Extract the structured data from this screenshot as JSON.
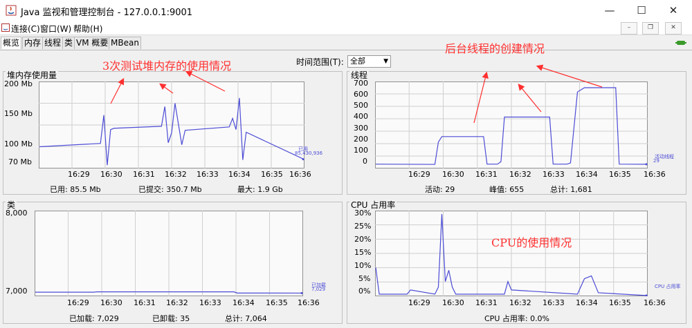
{
  "window": {
    "title": "Java 监视和管理控制台 - 127.0.0.1:9001",
    "minimize": "—",
    "maximize": "☐",
    "close": "✕"
  },
  "menu": {
    "items": [
      "连接(C)",
      "窗口(W)",
      "帮助(H)"
    ],
    "mdi_min": "–",
    "mdi_restore": "❐",
    "mdi_close": "✕"
  },
  "tabs": [
    "概览",
    "内存",
    "线程",
    "类",
    "VM 概要",
    "MBean"
  ],
  "time_range": {
    "label": "时间范围(T):",
    "value": "全部"
  },
  "annotations": {
    "heap": "3次测试堆内存的使用情况",
    "threads": "后台线程的创建情况",
    "cpu": "CPU的使用情况"
  },
  "x_ticks": [
    "16:29",
    "16:30",
    "16:31",
    "16:32",
    "16:33",
    "16:34",
    "16:35",
    "16:36"
  ],
  "heap": {
    "title": "堆内存使用量",
    "y_ticks": [
      "200 Mb",
      "150 Mb",
      "100 Mb",
      "70 Mb"
    ],
    "legend": "已用",
    "legend_value": "85,430,936",
    "footer": {
      "used": "已用:  85.5  Mb",
      "committed": "已提交:  350.7  Mb",
      "max": "最大:  1.9  Gb"
    }
  },
  "threads": {
    "title": "线程",
    "y_ticks": [
      "700",
      "600",
      "500",
      "400",
      "300",
      "200",
      "100",
      "0"
    ],
    "legend": "活动线程",
    "legend_value": "29",
    "footer": {
      "live": "活动:  29",
      "peak": "峰值:  655",
      "total": "总计:  1,681"
    }
  },
  "classes": {
    "title": "类",
    "y_ticks": [
      "8,000",
      "7,000"
    ],
    "legend": "已加载",
    "legend_value": "7,029",
    "footer": {
      "loaded": "已加载:  7,029",
      "unloaded": "已卸载:  35",
      "total": "总计:  7,064"
    }
  },
  "cpu": {
    "title": "CPU 占用率",
    "y_ticks": [
      "30%",
      "25%",
      "20%",
      "15%",
      "10%",
      "5%",
      "0%"
    ],
    "legend": "CPU 占用率",
    "footer": {
      "usage": "CPU 占用率:  0.0%"
    }
  },
  "colors": {
    "line": "#4b4bd6",
    "annotation": "#ff3030",
    "grid": "#cfcfcf"
  },
  "chart_data": [
    {
      "type": "line",
      "title": "堆内存使用量",
      "x": [
        "16:28.2",
        "16:30.0",
        "16:30.1",
        "16:30.2",
        "16:30.3",
        "16:30.4",
        "16:31.8",
        "16:31.9",
        "16:32.0",
        "16:32.1",
        "16:32.2",
        "16:32.4",
        "16:32.5",
        "16:33.8",
        "16:33.9",
        "16:34.0",
        "16:34.1",
        "16:34.2",
        "16:34.3",
        "16:36.0"
      ],
      "series": [
        {
          "name": "已用",
          "values": [
            102,
            107,
            150,
            74,
            128,
            130,
            133,
            163,
            108,
            123,
            168,
            105,
            127,
            132,
            145,
            128,
            176,
            82,
            124,
            83
          ]
        }
      ],
      "ylim": [
        70,
        200
      ],
      "unit": "Mb"
    },
    {
      "type": "line",
      "title": "线程",
      "x": [
        "16:28.2",
        "16:29.9",
        "16:30.0",
        "16:30.1",
        "16:31.3",
        "16:31.4",
        "16:31.7",
        "16:31.8",
        "16:31.9",
        "16:33.2",
        "16:33.3",
        "16:33.7",
        "16:33.8",
        "16:34.0",
        "16:34.2",
        "16:35.0",
        "16:35.1",
        "16:35.2",
        "16:36.0"
      ],
      "series": [
        {
          "name": "活动线程",
          "values": [
            30,
            28,
            210,
            255,
            255,
            30,
            30,
            50,
            415,
            415,
            30,
            30,
            40,
            620,
            655,
            655,
            655,
            30,
            29
          ]
        }
      ],
      "ylim": [
        0,
        700
      ]
    },
    {
      "type": "line",
      "title": "类",
      "x": [
        "16:28.2",
        "16:29.9",
        "16:30.0",
        "16:34.0",
        "16:34.1",
        "16:36.0"
      ],
      "series": [
        {
          "name": "已加载",
          "values": [
            7040,
            7040,
            7044,
            7044,
            7030,
            7029
          ]
        }
      ],
      "ylim": [
        7000,
        8000
      ]
    },
    {
      "type": "line",
      "title": "CPU 占用率",
      "x": [
        "16:28.2",
        "16:28.3",
        "16:29.1",
        "16:29.2",
        "16:29.9",
        "16:30.0",
        "16:30.1",
        "16:30.2",
        "16:30.3",
        "16:30.4",
        "16:30.5",
        "16:31.9",
        "16:32.0",
        "16:32.1",
        "16:34.0",
        "16:34.2",
        "16:34.4",
        "16:34.6",
        "16:36.0"
      ],
      "series": [
        {
          "name": "CPU 占用率",
          "values": [
            10,
            0.5,
            0.5,
            2,
            0.5,
            3,
            29,
            5,
            9,
            3,
            0.5,
            0.5,
            5,
            2,
            0.5,
            6,
            7,
            1,
            0
          ]
        }
      ],
      "ylim": [
        0,
        30
      ],
      "unit": "%"
    }
  ]
}
